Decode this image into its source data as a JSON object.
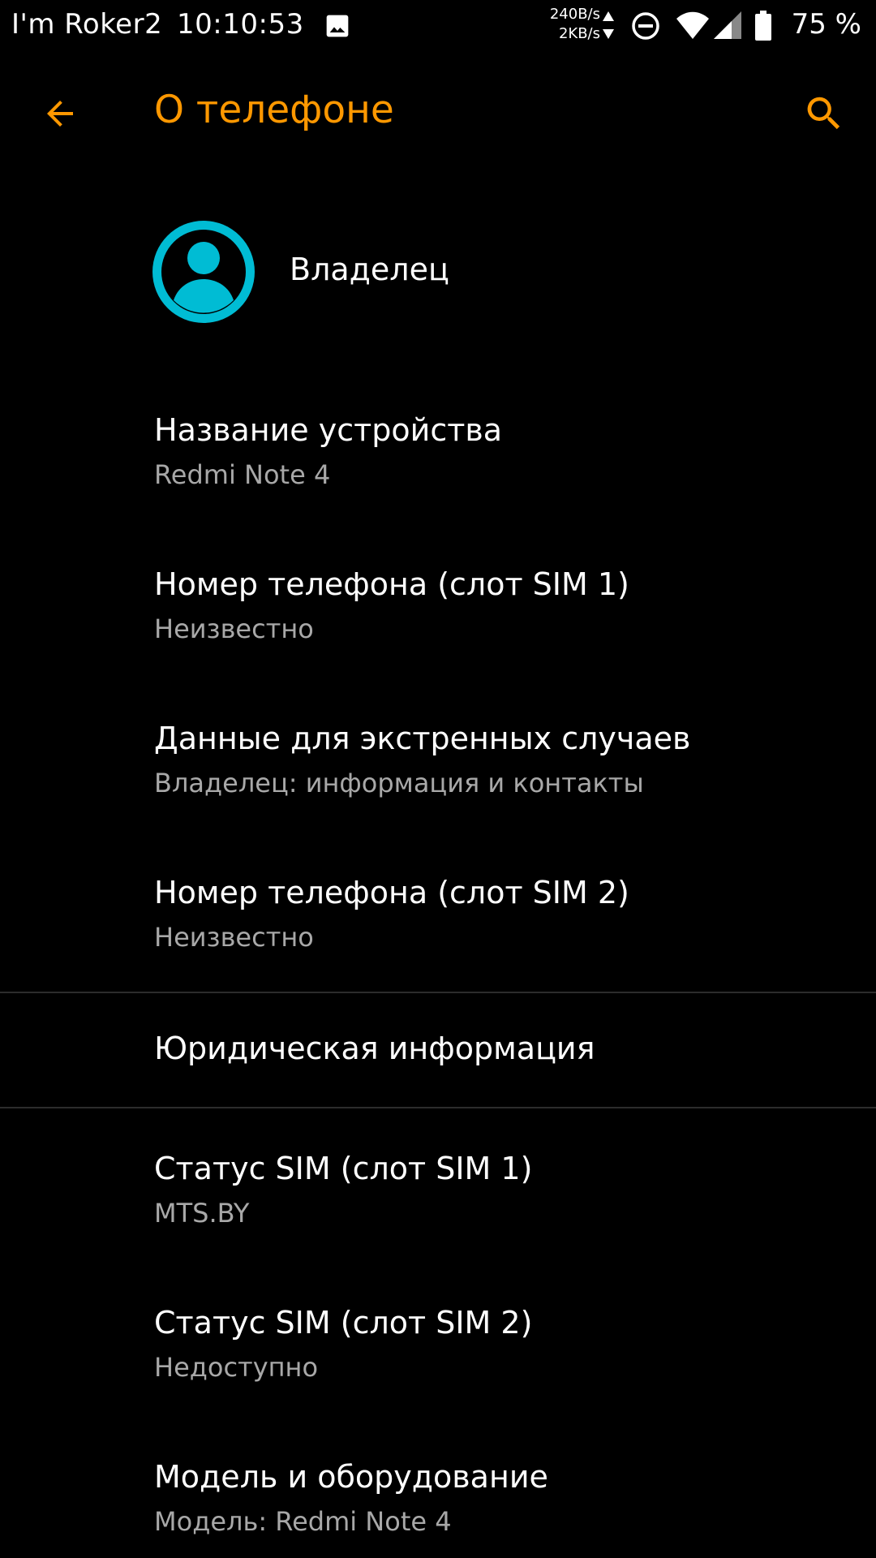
{
  "status_bar": {
    "carrier": "I'm Roker2",
    "time": "10:10:53",
    "speed_up": "240B/s",
    "speed_down": "2KB/s",
    "battery": "75 %",
    "icons": [
      "image-icon",
      "data-updown-icon",
      "do-not-disturb-icon",
      "wifi-icon",
      "cell-signal-icon",
      "battery-icon"
    ]
  },
  "app_bar": {
    "title": "О телефоне",
    "accent_color": "#ff9800"
  },
  "owner": {
    "name": "Владелец",
    "avatar_color": "#00bcd4"
  },
  "items": [
    {
      "title": "Название устройства",
      "subtitle": "Redmi Note 4"
    },
    {
      "title": "Номер телефона (слот SIM 1)",
      "subtitle": "Неизвестно"
    },
    {
      "title": "Данные для экстренных случаев",
      "subtitle": "Владелец: информация и контакты"
    },
    {
      "title": "Номер телефона (слот SIM 2)",
      "subtitle": "Неизвестно"
    },
    {
      "title": "Юридическая информация"
    },
    {
      "title": "Статус SIM (слот SIM 1)",
      "subtitle": "MTS.BY"
    },
    {
      "title": "Статус SIM (слот SIM 2)",
      "subtitle": "Недоступно"
    },
    {
      "title": "Модель и оборудование",
      "subtitle": "Модель: Redmi Note 4"
    }
  ]
}
